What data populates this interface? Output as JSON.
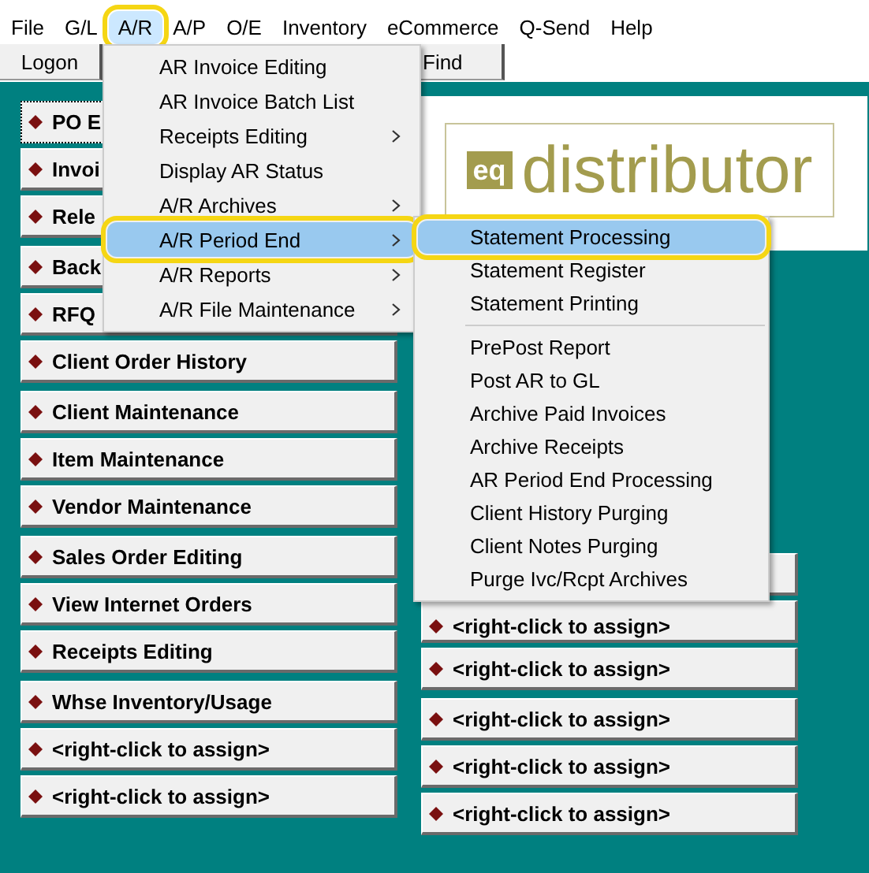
{
  "menu_bar": [
    {
      "label": "File",
      "selected": false,
      "highlighted": false
    },
    {
      "label": "G/L",
      "selected": false,
      "highlighted": false
    },
    {
      "label": "A/R",
      "selected": true,
      "highlighted": true
    },
    {
      "label": "A/P",
      "selected": false,
      "highlighted": false
    },
    {
      "label": "O/E",
      "selected": false,
      "highlighted": false
    },
    {
      "label": "Inventory",
      "selected": false,
      "highlighted": false
    },
    {
      "label": "eCommerce",
      "selected": false,
      "highlighted": false
    },
    {
      "label": "Q-Send",
      "selected": false,
      "highlighted": false
    },
    {
      "label": "Help",
      "selected": false,
      "highlighted": false
    }
  ],
  "toolbar": [
    {
      "label": "Logon"
    },
    {
      "label": "Find"
    }
  ],
  "logo": {
    "badge": "eq",
    "name": "distributor"
  },
  "left_groups": [
    {
      "buttons": [
        {
          "label": "PO E",
          "focused": true
        },
        {
          "label": "Invoi",
          "focused": false
        },
        {
          "label": "Rele",
          "focused": false
        }
      ]
    },
    {
      "buttons": [
        {
          "label": "Back",
          "focused": false
        },
        {
          "label": "RFQ",
          "focused": false
        },
        {
          "label": "Client Order History",
          "focused": false
        }
      ]
    },
    {
      "buttons": [
        {
          "label": "Client Maintenance",
          "focused": false
        },
        {
          "label": "Item Maintenance",
          "focused": false
        },
        {
          "label": "Vendor Maintenance",
          "focused": false
        }
      ]
    },
    {
      "buttons": [
        {
          "label": "Sales Order Editing",
          "focused": false
        },
        {
          "label": "View Internet Orders",
          "focused": false
        },
        {
          "label": "Receipts Editing",
          "focused": false
        }
      ]
    },
    {
      "buttons": [
        {
          "label": "Whse Inventory/Usage",
          "focused": false
        },
        {
          "label": "<right-click to assign>",
          "focused": false
        },
        {
          "label": "<right-click to assign>",
          "focused": false
        }
      ]
    }
  ],
  "right_groups": [
    {
      "buttons": [
        {
          "focused": false
        },
        {
          "label": "<right-click to assign>",
          "focused": false
        },
        {
          "label": "<right-click to assign>",
          "focused": false
        }
      ]
    },
    {
      "buttons": [
        {
          "label": "<right-click to assign>",
          "focused": false
        },
        {
          "label": "<right-click to assign>",
          "focused": false
        },
        {
          "label": "<right-click to assign>",
          "focused": false
        }
      ]
    }
  ],
  "ar_menu": [
    {
      "label": "AR Invoice Editing",
      "submenu": false,
      "selected": false,
      "highlighted": false
    },
    {
      "label": "AR Invoice Batch List",
      "submenu": false,
      "selected": false,
      "highlighted": false
    },
    {
      "label": "Receipts Editing",
      "submenu": true,
      "selected": false,
      "highlighted": false
    },
    {
      "label": "Display AR Status",
      "submenu": false,
      "selected": false,
      "highlighted": false
    },
    {
      "label": "A/R Archives",
      "submenu": true,
      "selected": false,
      "highlighted": false
    },
    {
      "label": "A/R Period End",
      "submenu": true,
      "selected": true,
      "highlighted": true
    },
    {
      "label": "A/R Reports",
      "submenu": true,
      "selected": false,
      "highlighted": false
    },
    {
      "label": "A/R File Maintenance",
      "submenu": true,
      "selected": false,
      "highlighted": false
    }
  ],
  "period_end_menu": [
    {
      "kind": "item",
      "label": "Statement Processing",
      "selected": true,
      "highlighted": true
    },
    {
      "kind": "item",
      "label": "Statement Register",
      "selected": false,
      "highlighted": false
    },
    {
      "kind": "item",
      "label": "Statement Printing",
      "selected": false,
      "highlighted": false
    },
    {
      "kind": "separator"
    },
    {
      "kind": "item",
      "label": "PrePost Report",
      "selected": false,
      "highlighted": false
    },
    {
      "kind": "item",
      "label": "Post AR to GL",
      "selected": false,
      "highlighted": false
    },
    {
      "kind": "item",
      "label": "Archive Paid Invoices",
      "selected": false,
      "highlighted": false
    },
    {
      "kind": "item",
      "label": "Archive Receipts",
      "selected": false,
      "highlighted": false
    },
    {
      "kind": "item",
      "label": "AR Period End Processing",
      "selected": false,
      "highlighted": false
    },
    {
      "kind": "item",
      "label": "Client History Purging",
      "selected": false,
      "highlighted": false
    },
    {
      "kind": "item",
      "label": "Client Notes Purging",
      "selected": false,
      "highlighted": false
    },
    {
      "kind": "item",
      "label": "Purge Ivc/Rcpt Archives",
      "selected": false,
      "highlighted": false
    }
  ]
}
